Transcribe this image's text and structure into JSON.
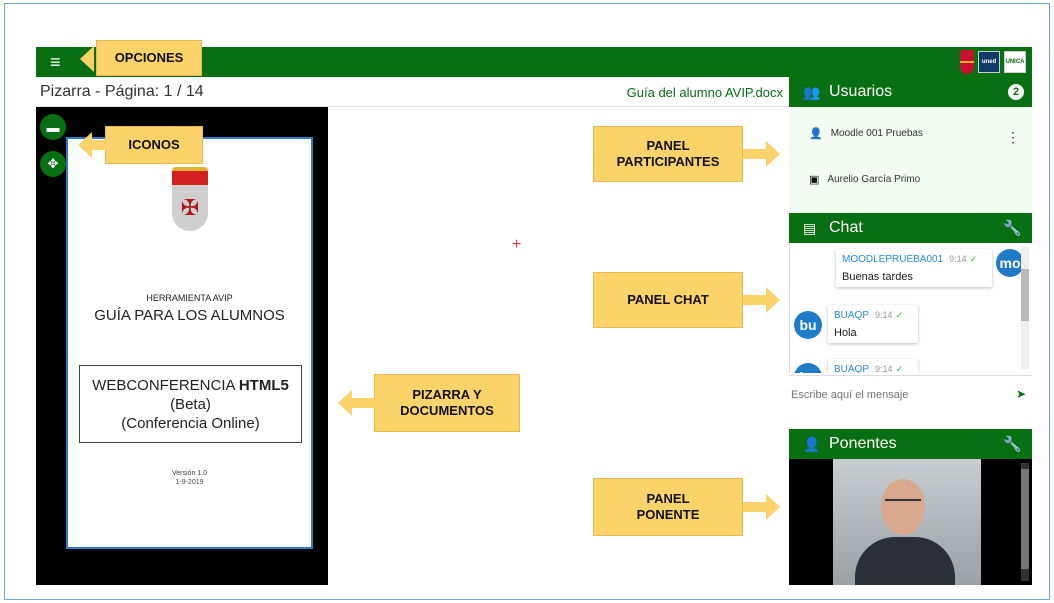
{
  "topbar": {
    "menu_icon": "hamburger-icon",
    "logos": [
      "crest-logo",
      "uned-logo",
      "unica-logo"
    ],
    "uned_text": "uned",
    "unica_text": "UNICA"
  },
  "whiteboard": {
    "page_label": "Pizarra - Página: 1 / 14",
    "document_name": "Guía del alumno AVIP.docx"
  },
  "document": {
    "small_title": "HERRAMIENTA AVIP",
    "heading": "GUÍA PARA LOS ALUMNOS",
    "box_line1": "WEBCONFERENCIA ",
    "box_line1_bold": "HTML5",
    "box_line2": "(Beta)",
    "box_line3": "(Conferencia Online)",
    "version": "Versión 1.0",
    "date": "1-9-2019"
  },
  "tools": [
    {
      "icon": "folder-icon"
    },
    {
      "icon": "move-icon"
    }
  ],
  "users_panel": {
    "title": "Usuarios",
    "count": "2",
    "users": [
      {
        "name": "Moodle 001 Pruebas",
        "icon": "user-icon"
      },
      {
        "name": "Aurelio García Primo",
        "icon": "presenter-icon"
      }
    ]
  },
  "chat_panel": {
    "title": "Chat",
    "messages": [
      {
        "author": "MOODLEPRUEBA001",
        "time": "9:14",
        "text": "Buenas tardes",
        "avatar": "mo"
      },
      {
        "author": "BUAQP",
        "time": "9:14",
        "text": "Hola",
        "avatar": "bu"
      },
      {
        "author": "BUAQP",
        "time": "9:14",
        "text": "",
        "avatar": "bu"
      }
    ],
    "input_placeholder": "Escribe aquí el mensaje"
  },
  "speakers_panel": {
    "title": "Ponentes"
  },
  "callouts": {
    "options": "OPCIONES",
    "icons": "ICONOS",
    "participants": [
      "PANEL",
      "PARTICIPANTES"
    ],
    "chat": "PANEL CHAT",
    "board": [
      "PIZARRA Y",
      "DOCUMENTOS"
    ],
    "speaker": [
      "PANEL",
      "PONENTE"
    ]
  },
  "colors": {
    "primary_green": "#086f12",
    "callout_yellow": "#fcd36b",
    "link_blue": "#2a8ad4"
  }
}
